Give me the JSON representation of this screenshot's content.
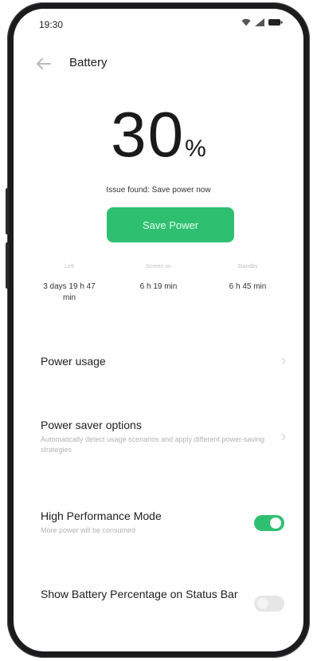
{
  "status_bar": {
    "time": "19:30"
  },
  "header": {
    "title": "Battery",
    "back_icon": "back-arrow-icon"
  },
  "battery": {
    "percent_value": "30",
    "percent_sign": "%",
    "issue_text": "Issue found: Save power now"
  },
  "save_button": {
    "label": "Save Power"
  },
  "stats": [
    {
      "label": "Left",
      "value": "3 days 19 h 47 min"
    },
    {
      "label": "Screen on",
      "value": "6 h 19 min"
    },
    {
      "label": "Standby",
      "value": "6 h 45 min"
    }
  ],
  "settings": {
    "power_usage": {
      "title": "Power usage"
    },
    "power_saver": {
      "title": "Power saver options",
      "subtitle": "Automatically detect usage scenarios and apply different power-saving strategies"
    },
    "high_performance": {
      "title": "High Performance Mode",
      "subtitle": "More power will be consumed",
      "enabled": true
    },
    "show_percentage": {
      "title": "Show Battery Percentage on Status Bar",
      "enabled": false
    }
  },
  "colors": {
    "accent": "#2fbf71",
    "frame": "#1b1b1d"
  }
}
